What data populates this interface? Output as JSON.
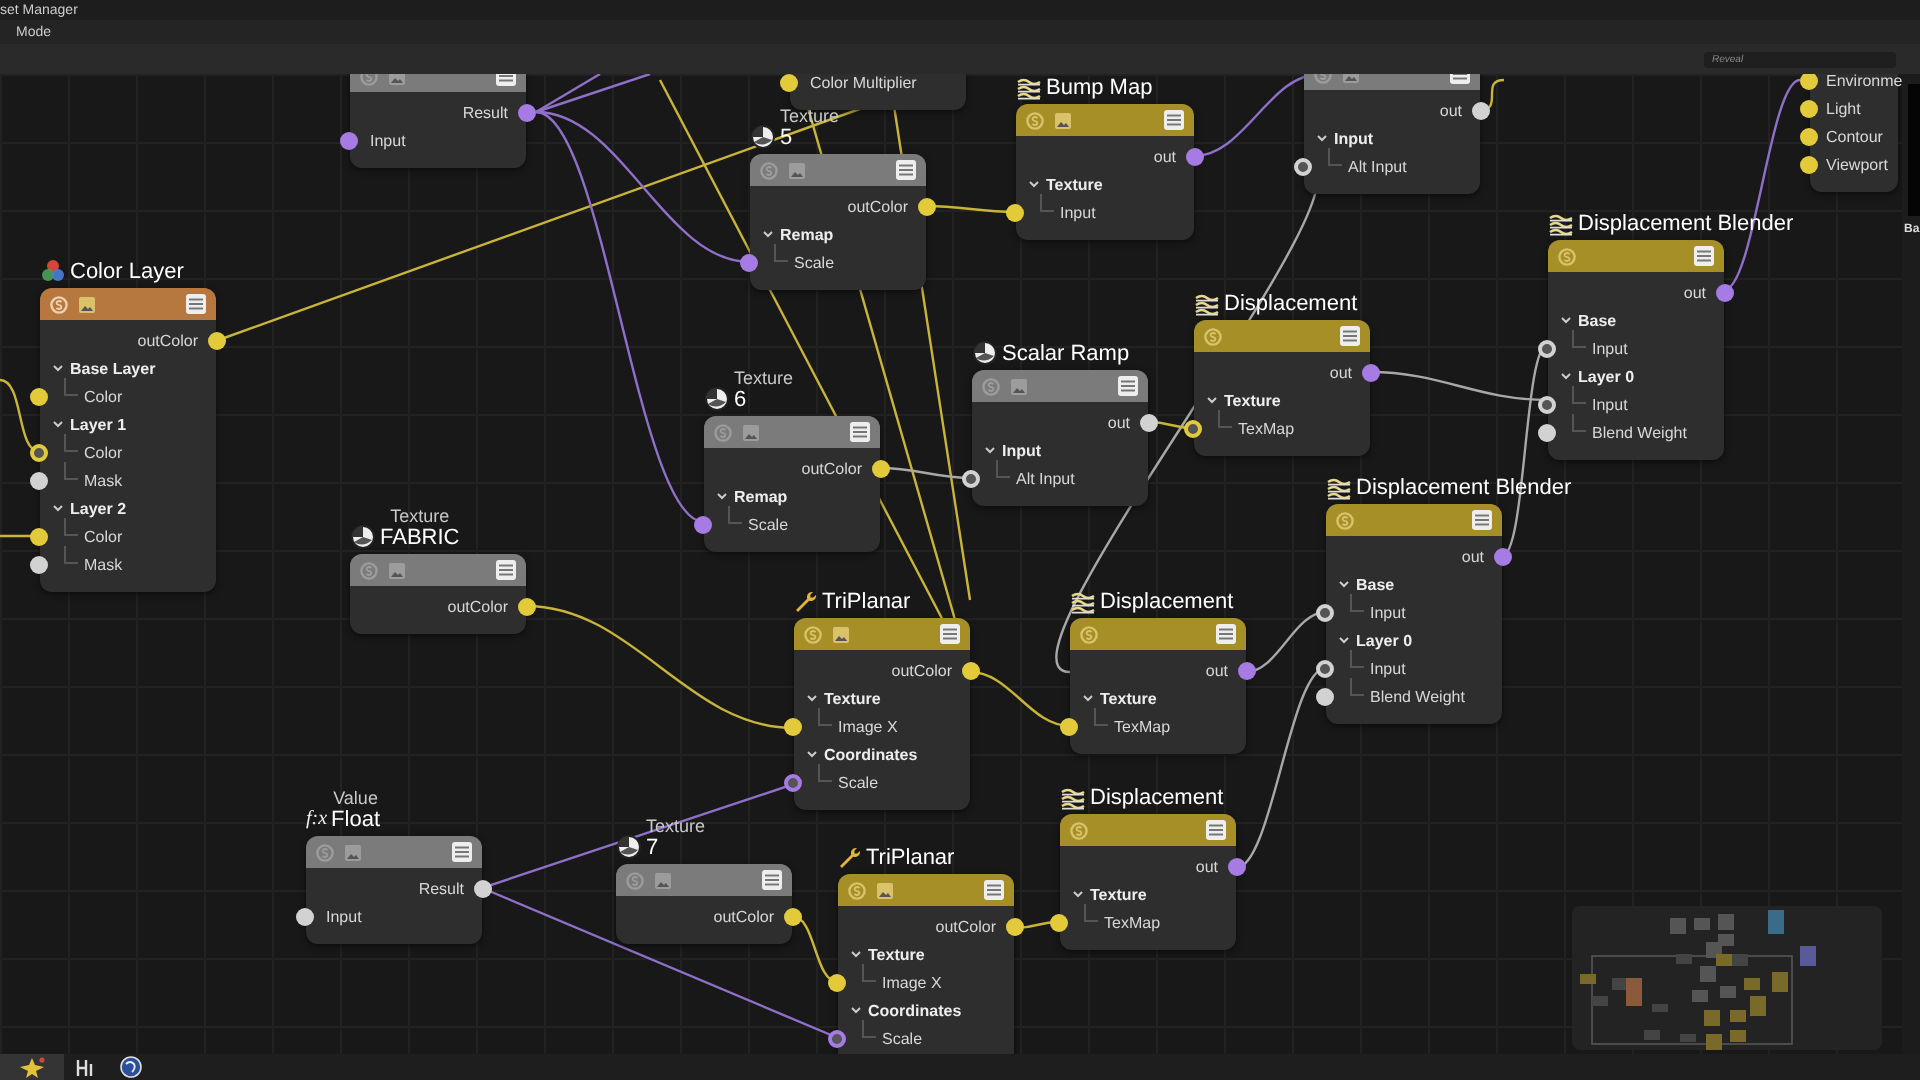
{
  "window": {
    "title": "set Manager"
  },
  "menu": [
    "Mode"
  ],
  "search": {
    "placeholder": "Reveal"
  },
  "nodes": [
    {
      "kind": "source",
      "preview": true,
      "rows": [
        {
          "kind": "output",
          "label": "Result",
          "color": "#a67be3"
        },
        {
          "kind": "input",
          "label": "Input",
          "color": "#a67be3",
          "linked": false
        }
      ]
    },
    {
      "rows": [
        {
          "kind": "input",
          "label": "Color Multiplier",
          "color": "#e2ca3b",
          "linked": false
        }
      ]
    },
    {
      "label": "Texture",
      "title": "5",
      "kind": "source",
      "preview": true,
      "rows": [
        {
          "kind": "output",
          "label": "outColor",
          "color": "#e2ca3b"
        },
        {
          "kind": "section",
          "label": "Remap",
          "expanded": true,
          "children": [
            {
              "kind": "input",
              "label": "Scale",
              "color": "#a67be3",
              "linked": false
            }
          ]
        }
      ]
    },
    {
      "title": "Bump Map",
      "kind": "shader",
      "preview": true,
      "rows": [
        {
          "kind": "output",
          "label": "out",
          "color": "#a67be3"
        },
        {
          "kind": "section",
          "label": "Texture",
          "expanded": true,
          "children": [
            {
              "kind": "input",
              "label": "Input",
              "color": "#e2ca3b",
              "linked": false
            }
          ]
        }
      ]
    },
    {
      "kind": "source",
      "preview": true,
      "rows": [
        {
          "kind": "output",
          "label": "out",
          "color": "#d2d2d2"
        },
        {
          "kind": "section",
          "label": "Input",
          "expanded": true,
          "children": [
            {
              "kind": "input",
              "label": "Alt Input",
              "color": "#d2d2d2",
              "linked": true
            }
          ]
        }
      ]
    },
    {
      "rows": [
        {
          "kind": "input",
          "label": "Environme",
          "color": "#e2ca3b",
          "linked": false
        },
        {
          "kind": "input",
          "label": "Light",
          "color": "#e2ca3b",
          "linked": false
        },
        {
          "kind": "input",
          "label": "Contour",
          "color": "#e2ca3b",
          "linked": false
        },
        {
          "kind": "input",
          "label": "Viewport",
          "color": "#e2ca3b",
          "linked": false
        }
      ]
    },
    {
      "title": "Color Layer",
      "kind": "layer",
      "preview": true,
      "rows": [
        {
          "kind": "output",
          "label": "outColor",
          "color": "#e2ca3b"
        },
        {
          "kind": "section",
          "label": "Base Layer",
          "expanded": true,
          "children": [
            {
              "kind": "input",
              "label": "Color",
              "color": "#e2ca3b",
              "linked": false
            }
          ]
        },
        {
          "kind": "section",
          "label": "Layer 1",
          "expanded": true,
          "children": [
            {
              "kind": "input",
              "label": "Color",
              "color": "#e2ca3b",
              "linked": true
            },
            {
              "kind": "input",
              "label": "Mask",
              "color": "#d2d2d2",
              "linked": false
            }
          ]
        },
        {
          "kind": "section",
          "label": "Layer 2",
          "expanded": true,
          "children": [
            {
              "kind": "input",
              "label": "Color",
              "color": "#e2ca3b",
              "linked": false
            },
            {
              "kind": "input",
              "label": "Mask",
              "color": "#d2d2d2",
              "linked": false
            }
          ]
        }
      ]
    },
    {
      "label": "Texture",
      "title": "6",
      "kind": "source",
      "preview": true,
      "rows": [
        {
          "kind": "output",
          "label": "outColor",
          "color": "#e2ca3b"
        },
        {
          "kind": "section",
          "label": "Remap",
          "expanded": true,
          "children": [
            {
              "kind": "input",
              "label": "Scale",
              "color": "#a67be3",
              "linked": false
            }
          ]
        }
      ]
    },
    {
      "title": "Scalar Ramp",
      "kind": "source",
      "preview": true,
      "rows": [
        {
          "kind": "output",
          "label": "out",
          "color": "#d2d2d2"
        },
        {
          "kind": "section",
          "label": "Input",
          "expanded": true,
          "children": [
            {
              "kind": "input",
              "label": "Alt Input",
              "color": "#d2d2d2",
              "linked": true
            }
          ]
        }
      ]
    },
    {
      "title": "Displacement",
      "kind": "shader",
      "preview": false,
      "rows": [
        {
          "kind": "output",
          "label": "out",
          "color": "#a67be3"
        },
        {
          "kind": "section",
          "label": "Texture",
          "expanded": true,
          "children": [
            {
              "kind": "input",
              "label": "TexMap",
              "color": "#e2ca3b",
              "linked": true
            }
          ]
        }
      ]
    },
    {
      "title": "Displacement Blender",
      "kind": "shader",
      "preview": false,
      "rows": [
        {
          "kind": "output",
          "label": "out",
          "color": "#a67be3"
        },
        {
          "kind": "section",
          "label": "Base",
          "expanded": true,
          "children": [
            {
              "kind": "input",
              "label": "Input",
              "color": "#d2d2d2",
              "linked": true
            }
          ]
        },
        {
          "kind": "section",
          "label": "Layer 0",
          "expanded": true,
          "children": [
            {
              "kind": "input",
              "label": "Input",
              "color": "#d2d2d2",
              "linked": true
            },
            {
              "kind": "input",
              "label": "Blend Weight",
              "color": "#d2d2d2",
              "linked": false
            }
          ]
        }
      ]
    },
    {
      "label": "Texture",
      "title": "FABRIC",
      "kind": "source",
      "preview": true,
      "rows": [
        {
          "kind": "output",
          "label": "outColor",
          "color": "#e2ca3b"
        }
      ]
    },
    {
      "title": "TriPlanar",
      "kind": "shader",
      "preview": true,
      "rows": [
        {
          "kind": "output",
          "label": "outColor",
          "color": "#e2ca3b"
        },
        {
          "kind": "section",
          "label": "Texture",
          "expanded": true,
          "children": [
            {
              "kind": "input",
              "label": "Image X",
              "color": "#e2ca3b",
              "linked": false
            }
          ]
        },
        {
          "kind": "section",
          "label": "Coordinates",
          "expanded": true,
          "children": [
            {
              "kind": "input",
              "label": "Scale",
              "color": "#a67be3",
              "linked": true
            }
          ]
        }
      ]
    },
    {
      "title": "Displacement",
      "kind": "shader",
      "preview": false,
      "rows": [
        {
          "kind": "output",
          "label": "out",
          "color": "#a67be3"
        },
        {
          "kind": "section",
          "label": "Texture",
          "expanded": true,
          "children": [
            {
              "kind": "input",
              "label": "TexMap",
              "color": "#e2ca3b",
              "linked": false
            }
          ]
        }
      ]
    },
    {
      "title": "Displacement Blender",
      "kind": "shader",
      "preview": false,
      "rows": [
        {
          "kind": "output",
          "label": "out",
          "color": "#a67be3"
        },
        {
          "kind": "section",
          "label": "Base",
          "expanded": true,
          "children": [
            {
              "kind": "input",
              "label": "Input",
              "color": "#d2d2d2",
              "linked": true
            }
          ]
        },
        {
          "kind": "section",
          "label": "Layer 0",
          "expanded": true,
          "children": [
            {
              "kind": "input",
              "label": "Input",
              "color": "#d2d2d2",
              "linked": true
            },
            {
              "kind": "input",
              "label": "Blend Weight",
              "color": "#d2d2d2",
              "linked": false
            }
          ]
        }
      ]
    },
    {
      "label": "Value",
      "title": "Float",
      "glyph": "f:x",
      "kind": "source",
      "preview": true,
      "rows": [
        {
          "kind": "output",
          "label": "Result",
          "color": "#d2d2d2"
        },
        {
          "kind": "input",
          "label": "Input",
          "color": "#d2d2d2",
          "linked": false
        }
      ]
    },
    {
      "label": "Texture",
      "title": "7",
      "kind": "source",
      "preview": true,
      "rows": [
        {
          "kind": "output",
          "label": "outColor",
          "color": "#e2ca3b"
        }
      ]
    },
    {
      "title": "TriPlanar",
      "kind": "shader",
      "preview": true,
      "rows": [
        {
          "kind": "output",
          "label": "outColor",
          "color": "#e2ca3b"
        },
        {
          "kind": "section",
          "label": "Texture",
          "expanded": true,
          "children": [
            {
              "kind": "input",
              "label": "Image X",
              "color": "#e2ca3b",
              "linked": false
            }
          ]
        },
        {
          "kind": "section",
          "label": "Coordinates",
          "expanded": true,
          "children": [
            {
              "kind": "input",
              "label": "Scale",
              "color": "#a67be3",
              "linked": true
            }
          ]
        }
      ]
    },
    {
      "title": "Displacement",
      "kind": "shader",
      "preview": false,
      "rows": [
        {
          "kind": "output",
          "label": "out",
          "color": "#a67be3"
        },
        {
          "kind": "section",
          "label": "Texture",
          "expanded": true,
          "children": [
            {
              "kind": "input",
              "label": "TexMap",
              "color": "#e2ca3b",
              "linked": false
            }
          ]
        }
      ]
    }
  ],
  "side_panel": {
    "heading": "Ba"
  },
  "taskbar": [
    {
      "kind": "sparkle",
      "selected": true
    },
    {
      "kind": "panel",
      "selected": false
    },
    {
      "kind": "globe",
      "selected": false
    }
  ]
}
